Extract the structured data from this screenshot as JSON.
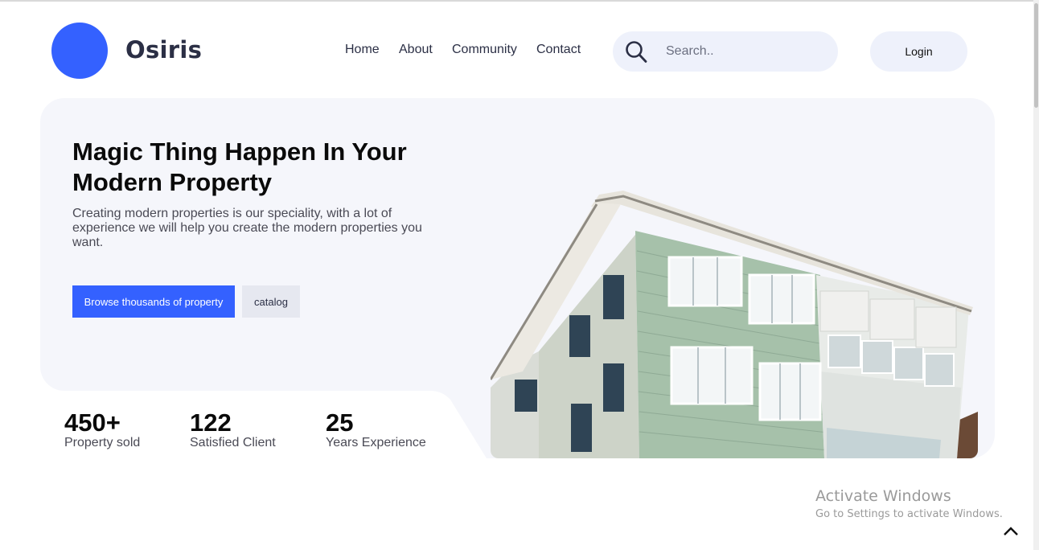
{
  "brand": {
    "name": "Osiris",
    "color": "#3461ff"
  },
  "nav": {
    "items": [
      "Home",
      "About",
      "Community",
      "Contact"
    ]
  },
  "search": {
    "placeholder": "Search..",
    "icon": "search-icon"
  },
  "login": {
    "label": "Login"
  },
  "hero": {
    "title": "Magic Thing Happen In Your Modern Property",
    "description": "Creating modern properties is our speciality, with a lot of experience we will help you create the modern properties you want.",
    "primary_button": "Browse thousands of property",
    "secondary_button": "catalog"
  },
  "stats": [
    {
      "value": "450+",
      "label": "Property sold"
    },
    {
      "value": "122",
      "label": "Satisfied Client"
    },
    {
      "value": "25",
      "label": "Years Experience"
    }
  ],
  "watermark": {
    "title": "Activate Windows",
    "subtitle": "Go to Settings to activate Windows."
  },
  "colors": {
    "accent": "#3461ff",
    "hero_bg": "#f5f6fb",
    "button_bg": "#eef1fb"
  }
}
